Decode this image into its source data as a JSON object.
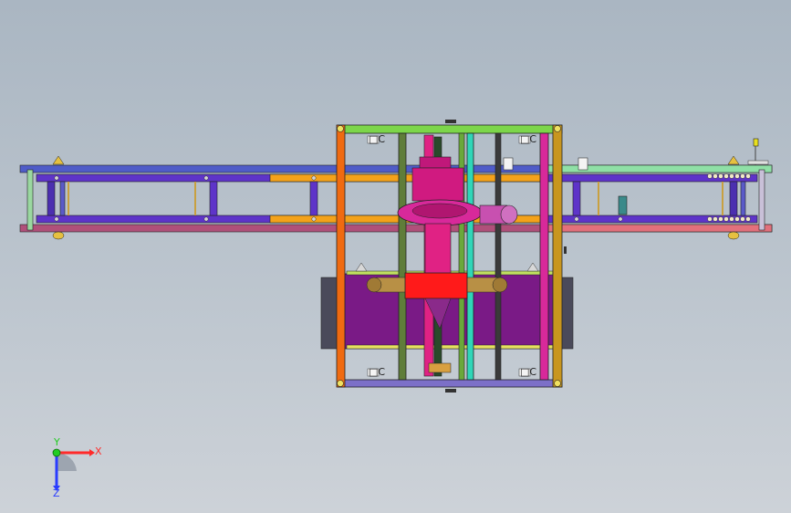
{
  "viewport": {
    "background_top": "#aab6c2",
    "background_bottom": "#cdd2d8"
  },
  "model": {
    "colors": {
      "top_rail": "#4f5cc8",
      "bottom_rail": "#b0507a",
      "frame_green": "#7cd64a",
      "frame_orange": "#f06a10",
      "frame_gold": "#c8961e",
      "frame_magenta": "#d8299a",
      "frame_olive": "#5f7d3a",
      "motor_pink": "#e02284",
      "pump_red": "#ff1a1a",
      "tank_purple": "#7a1a86",
      "pipe_brass": "#b89045"
    },
    "labels": {
      "clip": "□C"
    }
  },
  "triad": {
    "x_label": "X",
    "y_label": "Y",
    "z_label": "Z",
    "x_color": "#ff2a2a",
    "y_color": "#22cc22",
    "z_color": "#2a3cff"
  }
}
